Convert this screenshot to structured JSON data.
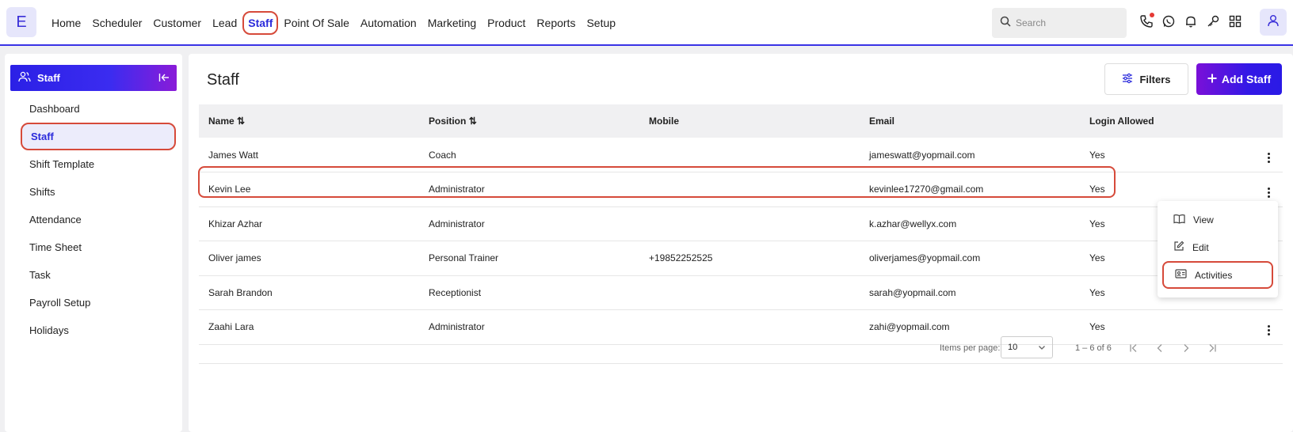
{
  "app": {
    "logo_letter": "E"
  },
  "nav": {
    "items": [
      "Home",
      "Scheduler",
      "Customer",
      "Lead",
      "Staff",
      "Point Of Sale",
      "Automation",
      "Marketing",
      "Product",
      "Reports",
      "Setup"
    ],
    "active": "Staff"
  },
  "search": {
    "placeholder": "Search"
  },
  "top_icons": [
    "phone-icon",
    "whatsapp-icon",
    "bell-icon",
    "key-icon",
    "apps-grid-icon",
    "user-icon"
  ],
  "sidebar": {
    "header": "Staff",
    "items": [
      "Dashboard",
      "Staff",
      "Shift Template",
      "Shifts",
      "Attendance",
      "Time Sheet",
      "Task",
      "Payroll Setup",
      "Holidays"
    ],
    "active": "Staff"
  },
  "main": {
    "title": "Staff",
    "filters_label": "Filters",
    "add_label": "Add Staff"
  },
  "table": {
    "headers": {
      "name": "Name",
      "position": "Position",
      "mobile": "Mobile",
      "email": "Email",
      "login": "Login Allowed"
    },
    "rows": [
      {
        "name": "James Watt",
        "position": "Coach",
        "mobile": "",
        "email": "jameswatt@yopmail.com",
        "login": "Yes"
      },
      {
        "name": "Kevin Lee",
        "position": "Administrator",
        "mobile": "",
        "email": "kevinlee17270@gmail.com",
        "login": "Yes"
      },
      {
        "name": "Khizar Azhar",
        "position": "Administrator",
        "mobile": "",
        "email": "k.azhar@wellyx.com",
        "login": "Yes"
      },
      {
        "name": "Oliver james",
        "position": "Personal Trainer",
        "mobile": "+19852252525",
        "email": "oliverjames@yopmail.com",
        "login": "Yes"
      },
      {
        "name": "Sarah Brandon",
        "position": "Receptionist",
        "mobile": "",
        "email": "sarah@yopmail.com",
        "login": "Yes"
      },
      {
        "name": "Zaahi Lara",
        "position": "Administrator",
        "mobile": "",
        "email": "zahi@yopmail.com",
        "login": "Yes"
      }
    ]
  },
  "pagination": {
    "items_per_page_label": "Items per page:",
    "items_per_page": "10",
    "range": "1 – 6 of 6"
  },
  "row_menu": {
    "items": [
      "View",
      "Edit",
      "Activities"
    ],
    "highlighted": "Activities"
  },
  "colors": {
    "accent": "#2b2bdb",
    "highlight": "#d64a3a",
    "brand_gradient_start": "#2b20e6",
    "brand_gradient_end": "#8a1bd8"
  }
}
